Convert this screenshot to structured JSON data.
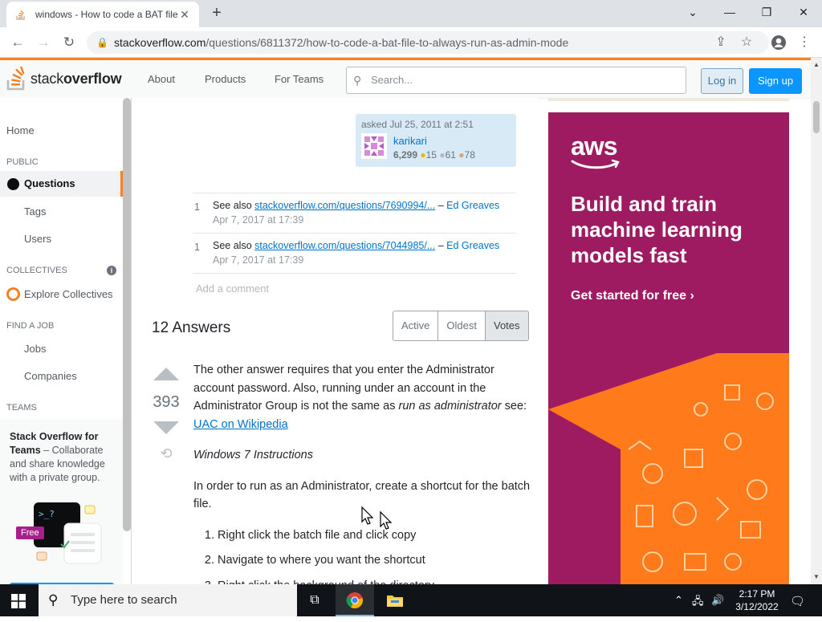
{
  "browser": {
    "tab_title": "windows - How to code a BAT file",
    "new_tab": "+",
    "close_tab": "✕",
    "url_host": "stackoverflow.com",
    "url_path": "/questions/6811372/how-to-code-a-bat-file-to-always-run-as-admin-mode"
  },
  "so_header": {
    "logo_word_a": "stack",
    "logo_word_b": "overflow",
    "nav": [
      "About",
      "Products",
      "For Teams"
    ],
    "search_placeholder": "Search...",
    "login": "Log in",
    "signup": "Sign up"
  },
  "leftnav": {
    "home": "Home",
    "public": "PUBLIC",
    "questions": "Questions",
    "tags": "Tags",
    "users": "Users",
    "collectives": "COLLECTIVES",
    "explore": "Explore Collectives",
    "find_job": "FIND A JOB",
    "jobs": "Jobs",
    "companies": "Companies",
    "teams": "TEAMS",
    "teams_title": "Stack Overflow for Teams",
    "teams_text": " – Collaborate and share knowledge with a private group.",
    "free_badge": "Free"
  },
  "question": {
    "asked": "asked Jul 25, 2011 at 2:51",
    "user": "karikari",
    "rep": "6,299",
    "gold": "15",
    "silver": "61",
    "bronze": "78"
  },
  "comments": [
    {
      "score": "1",
      "prefix": "See also ",
      "link": "stackoverflow.com/questions/7690994/...",
      "dash": " – ",
      "user": "Ed Greaves",
      "time": "Apr 7, 2017 at 17:39"
    },
    {
      "score": "1",
      "prefix": "See also ",
      "link": "stackoverflow.com/questions/7044985/...",
      "dash": " – ",
      "user": "Ed Greaves",
      "time": "Apr 7, 2017 at 17:39"
    }
  ],
  "add_comment": "Add a comment",
  "answers": {
    "count_label": "12 Answers",
    "sort": [
      "Active",
      "Oldest",
      "Votes"
    ],
    "vote_count": "393",
    "p1_a": "The other answer requires that you enter the Administrator account password. Also, running under an account in the Administrator Group is not the same as ",
    "p1_em": "run as administrator",
    "p1_b": " see: ",
    "p1_link": "UAC on Wikipedia",
    "p2": "Windows 7 Instructions",
    "p3": "In order to run as an Administrator, create a shortcut for the batch file.",
    "steps": [
      "Right click the batch file and click copy",
      "Navigate to where you want the shortcut",
      "Right click the background of the directory"
    ]
  },
  "ad": {
    "brand": "aws",
    "headline": "Build and train machine learning models fast",
    "cta": "Get started for free ›",
    "bg_color": "#9f1b61",
    "accent_color": "#ff7a1a"
  },
  "taskbar": {
    "search": "Type here to search",
    "time": "2:17 PM",
    "date": "3/12/2022"
  }
}
